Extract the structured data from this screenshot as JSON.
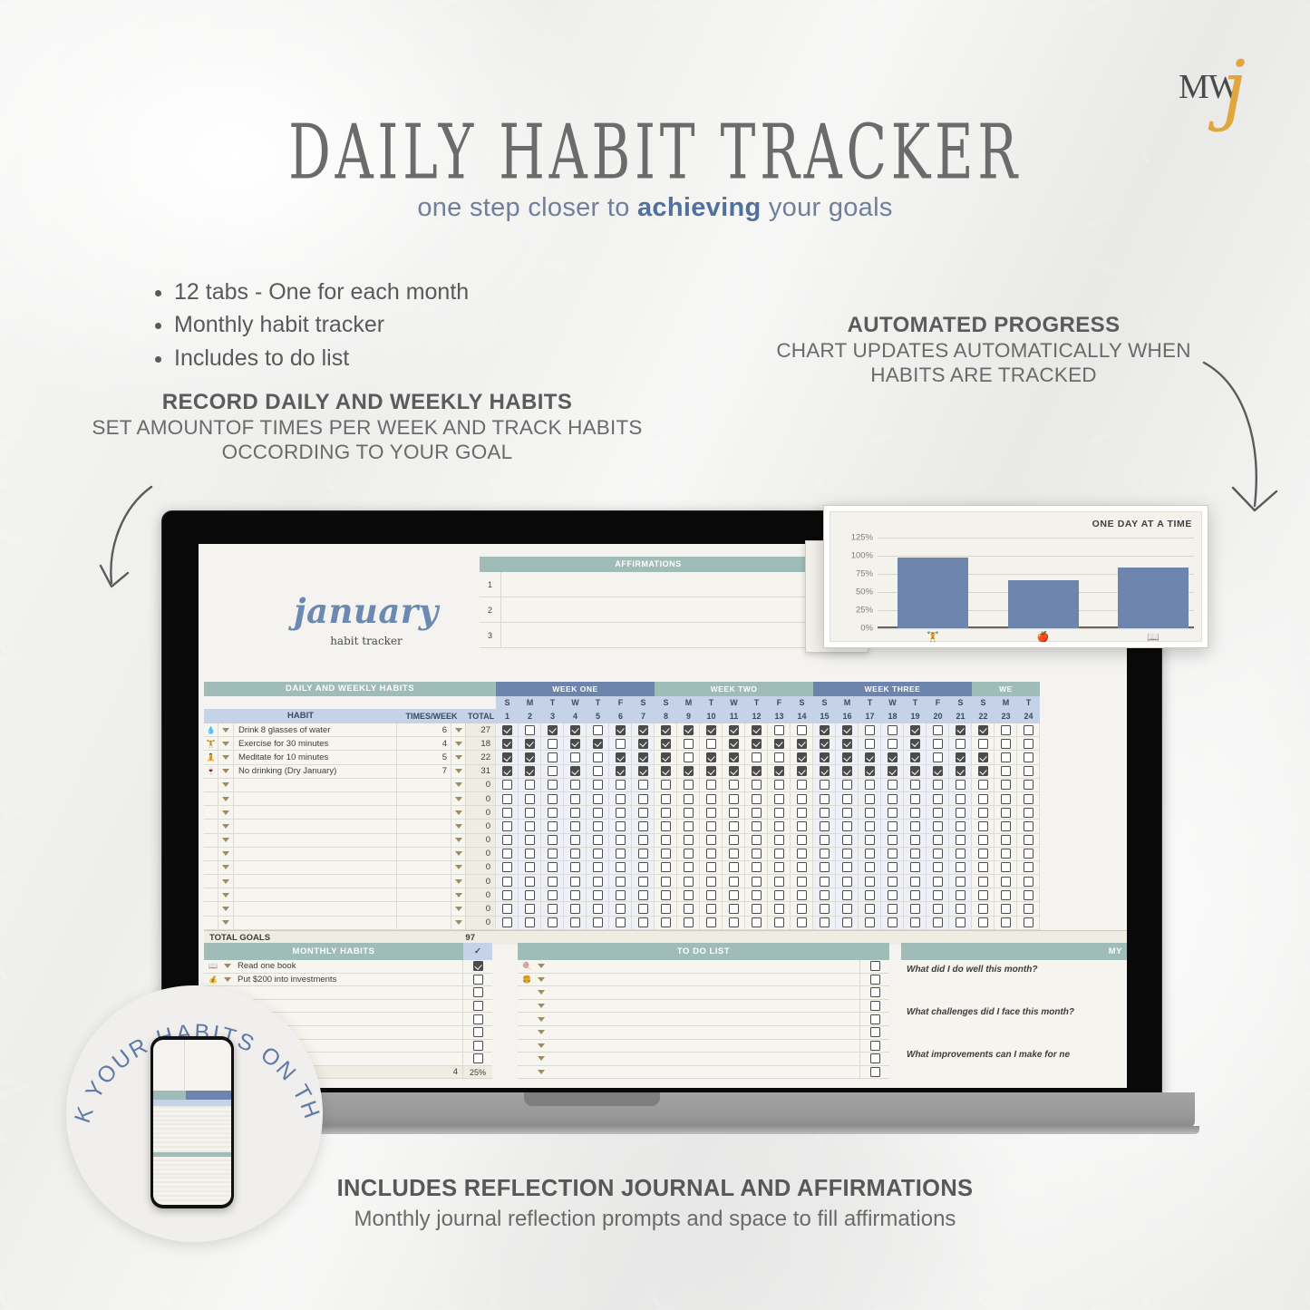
{
  "brand": {
    "mark": "MW",
    "script": "j"
  },
  "header": {
    "title": "DAILY HABIT TRACKER",
    "subtitle_pre": "one step closer to ",
    "subtitle_em": "achieving",
    "subtitle_post": " your goals"
  },
  "features": [
    "12 tabs - One for each month",
    "Monthly habit tracker",
    "Includes to do list"
  ],
  "annotations": {
    "left": {
      "heading": "RECORD DAILY AND WEEKLY HABITS",
      "line1": "SET AMOUNTOF TIMES PER WEEK AND TRACK HABITS",
      "line2": "OCCORDING TO YOUR GOAL"
    },
    "right": {
      "heading": "AUTOMATED PROGRESS",
      "line1": "CHART UPDATES AUTOMATICALLY WHEN",
      "line2": "HABITS ARE TRACKED"
    }
  },
  "caption": {
    "heading": "INCLUDES REFLECTION JOURNAL AND AFFIRMATIONS",
    "sub": "Monthly journal reflection prompts and space to fill affirmations"
  },
  "badge": {
    "text": "TRACK YOUR HABITS ON THE GO"
  },
  "spreadsheet": {
    "month": "january",
    "month_sub": "habit tracker",
    "affirmations": {
      "header": "AFFIRMATIONS",
      "rows": [
        "1",
        "2",
        "3"
      ]
    },
    "habits_table": {
      "title": "DAILY AND WEEKLY HABITS",
      "col_habit": "HABIT",
      "col_times": "TIMES/WEEK",
      "col_total": "TOTAL",
      "weeks": [
        {
          "label": "WEEK ONE",
          "style": "blue",
          "days": [
            "S",
            "M",
            "T",
            "W",
            "T",
            "F",
            "S"
          ],
          "dates": [
            1,
            2,
            3,
            4,
            5,
            6,
            7
          ]
        },
        {
          "label": "WEEK TWO",
          "style": "green",
          "days": [
            "S",
            "M",
            "T",
            "W",
            "T",
            "F",
            "S"
          ],
          "dates": [
            8,
            9,
            10,
            11,
            12,
            13,
            14
          ]
        },
        {
          "label": "WEEK THREE",
          "style": "blue",
          "days": [
            "S",
            "M",
            "T",
            "W",
            "T",
            "F",
            "S"
          ],
          "dates": [
            15,
            16,
            17,
            18,
            19,
            20,
            21
          ]
        },
        {
          "label": "WE",
          "style": "green",
          "days": [
            "S",
            "M",
            "T"
          ],
          "dates": [
            22,
            23,
            24
          ]
        }
      ],
      "rows": [
        {
          "icon": "💧",
          "name": "Drink 8 glasses of water",
          "times": "6",
          "total": "27",
          "checks": [
            1,
            0,
            1,
            1,
            0,
            1,
            1,
            1,
            1,
            1,
            1,
            1,
            0,
            0,
            1,
            1,
            0,
            0,
            1,
            0,
            1,
            1
          ]
        },
        {
          "icon": "🏋",
          "name": "Exercise for 30 minutes",
          "times": "4",
          "total": "18",
          "checks": [
            1,
            1,
            0,
            1,
            1,
            0,
            1,
            1,
            0,
            0,
            1,
            1,
            1,
            1,
            1,
            1,
            0,
            0,
            1,
            0,
            0,
            0
          ]
        },
        {
          "icon": "🧘",
          "name": "Meditate for 10 minutes",
          "times": "5",
          "total": "22",
          "checks": [
            1,
            1,
            0,
            0,
            0,
            1,
            1,
            1,
            0,
            1,
            1,
            0,
            0,
            1,
            1,
            1,
            1,
            1,
            1,
            0,
            1,
            1
          ]
        },
        {
          "icon": "🍷",
          "name": "No drinking (Dry January)",
          "times": "7",
          "total": "31",
          "checks": [
            1,
            1,
            0,
            1,
            0,
            1,
            1,
            1,
            1,
            1,
            1,
            1,
            1,
            1,
            1,
            1,
            1,
            1,
            1,
            1,
            1,
            1
          ]
        }
      ],
      "empty_rows": 11,
      "empty_total": "0",
      "total_goals_label": "TOTAL GOALS",
      "total_goals_value": "97"
    },
    "monthly_habits": {
      "title": "MONTHLY HABITS",
      "check_header": "✓",
      "rows": [
        {
          "icon": "📖",
          "name": "Read one book",
          "checked": true
        },
        {
          "icon": "💰",
          "name": "Put $200 into investments",
          "checked": false
        }
      ],
      "empty_rows": 6,
      "count": "4",
      "percent": "25%"
    },
    "todo": {
      "title": "TO DO LIST",
      "rows": [
        {
          "icon": "🍭"
        },
        {
          "icon": "🍔"
        },
        {
          "icon": ""
        },
        {
          "icon": ""
        },
        {
          "icon": ""
        },
        {
          "icon": ""
        },
        {
          "icon": ""
        },
        {
          "icon": ""
        },
        {
          "icon": ""
        }
      ]
    },
    "journal": {
      "title": "MY",
      "prompts": [
        "What did I do well this month?",
        "What challenges did I face this month?",
        "What improvements can I make for ne"
      ]
    }
  },
  "chart_data": {
    "type": "bar",
    "title": "ONE DAY AT A TIME",
    "categories": [
      "🏋",
      "🍎",
      "📖"
    ],
    "values": [
      97,
      66,
      84
    ],
    "xlabel": "",
    "ylabel": "",
    "ylim": [
      0,
      125
    ],
    "yticks": [
      125,
      100,
      75,
      50,
      25,
      0
    ],
    "ytick_labels": [
      "125%",
      "100%",
      "75%",
      "50%",
      "25%",
      "0%"
    ],
    "grid": true,
    "bar_color": "#6e85ad",
    "background": "#f4f2ec"
  },
  "chart_behind": {
    "ytick_labels": [
      "125%",
      "100%",
      "75%",
      "50%",
      "25%"
    ]
  },
  "colors": {
    "accent_blue": "#6d84ad",
    "accent_green": "#9fbcb8",
    "light_blue": "#c5d2e8",
    "gold": "#e0a63f",
    "sheet_bg": "#f4f3ef"
  }
}
